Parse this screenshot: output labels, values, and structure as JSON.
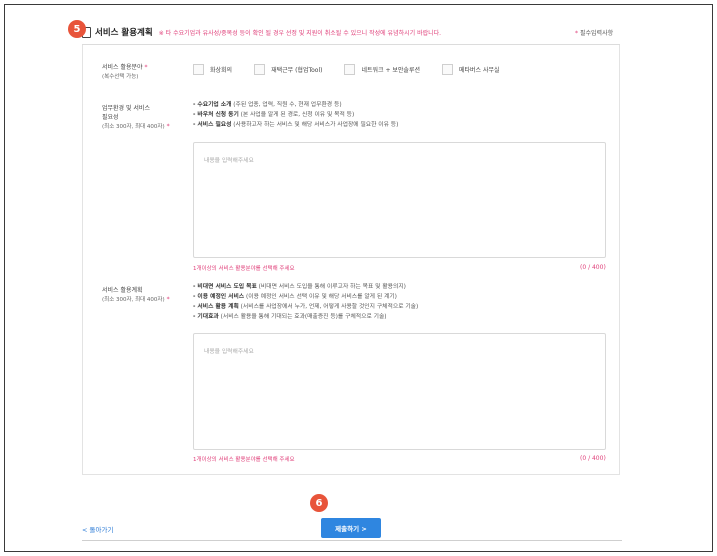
{
  "header": {
    "step_number": "5",
    "title": "서비스 활용계획",
    "notice": "※ 타 수요기업과 유사성/중복성 등이 확인 될 경우 선정 및 지원이 취소될 수 있으니 작성에 유념하시기 바랍니다.",
    "required_note": "필수입력사항"
  },
  "service_field": {
    "label": "서비스 활용분야",
    "sub": "(복수선택 가능)",
    "options": [
      "화상회의",
      "재택근무 (협업Tool)",
      "네트워크 + 보안솔루션",
      "메타버스 사무실"
    ]
  },
  "need_section": {
    "label_line1": "업무환경 및 서비스",
    "label_line2": "필요성",
    "limit": "(최소 300자, 최대 400자)",
    "bullets": [
      {
        "bold": "- 수요기업 소개",
        "rest": " (주된 업종, 업력, 직원 수, 현재 업무환경 등)"
      },
      {
        "bold": "- 바우처 신청 동기",
        "rest": " (본 사업을 알게 된 경로, 신청 이유 및 목적 등)"
      },
      {
        "bold": "- 서비스 필요성",
        "rest": " (사용하고자 하는 서비스 및 해당 서비스가 사업장에 필요한 이유 등)"
      }
    ],
    "placeholder": "내용을 입력해주세요",
    "warning": "1개이상의 서비스 활용분야를 선택해 주세요",
    "count": "(0 / 400)"
  },
  "plan_section": {
    "label": "서비스 활용계획",
    "limit": "(최소 300자, 최대 400자)",
    "bullets": [
      {
        "bold": "- 비대면 서비스 도입 목표",
        "rest": " (비대면 서비스 도입을 통해 이루고자 하는 목표 및 활용의지)"
      },
      {
        "bold": "- 이용 예정인 서비스",
        "rest": " (이용 예정인 서비스 선택 이유 및 해당 서비스를 알게 된 계기)"
      },
      {
        "bold": "- 서비스 활용 계획",
        "rest": " (서비스를 사업장에서 누가, 언제, 어떻게 사용할 것인지 구체적으로 기술)"
      },
      {
        "bold": "- 기대효과",
        "rest": " (서비스 활용을 통해 기대되는 효과(매출증진 등)를 구체적으로 기술)"
      }
    ],
    "placeholder": "내용을 입력해주세요",
    "warning": "1개이상의 서비스 활용분야를 선택해 주세요",
    "count": "(0 / 400)"
  },
  "footer": {
    "step_number": "6",
    "back_label": "< 돌아가기",
    "submit_label": "제출하기  >"
  },
  "colors": {
    "accent": "#2f86e0",
    "warning": "#e0407a",
    "badge": "#e8543a"
  }
}
